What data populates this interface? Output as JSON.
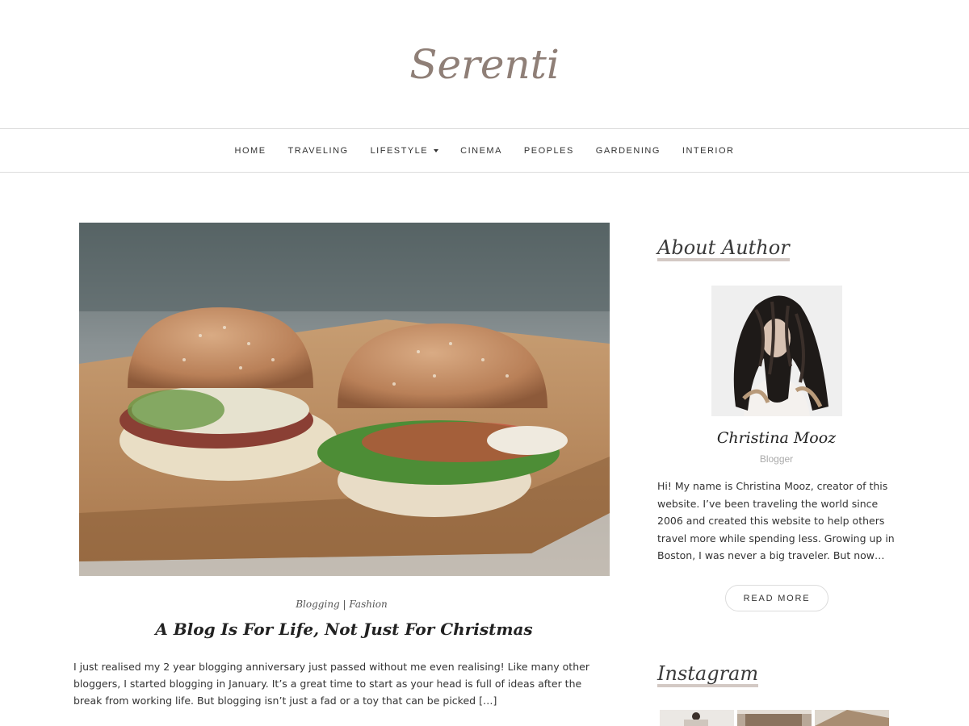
{
  "site": {
    "logo": "Serenti"
  },
  "nav": {
    "items": [
      {
        "label": "HOME"
      },
      {
        "label": "TRAVELING"
      },
      {
        "label": "LIFESTYLE",
        "has_dropdown": true
      },
      {
        "label": "CINEMA"
      },
      {
        "label": "PEOPLES"
      },
      {
        "label": "GARDENING"
      },
      {
        "label": "INTERIOR"
      }
    ]
  },
  "post": {
    "categories": "Blogging | Fashion",
    "title": "A Blog Is For Life, Not Just For Christmas",
    "excerpt": "I just realised my 2 year blogging anniversary just passed without me even realising! Like many other bloggers, I started blogging in January. It’s a great time to start as your head is full of ideas after the break from working life. But blogging isn’t just a fad or a toy that can be picked […]"
  },
  "sidebar": {
    "about": {
      "title": "About Author",
      "name": "Christina Mooz",
      "role": "Blogger",
      "bio": "Hi! My name is Christina Mooz, creator of this website. I’ve been traveling the world since 2006 and created this website to help others travel more while spending less. Growing up in Boston, I was never a big traveler. But now…",
      "read_more": "READ MORE"
    },
    "instagram": {
      "title": "Instagram"
    }
  },
  "colors": {
    "logo": "#8f7f77",
    "accent_underline": "#d3c9c4"
  }
}
